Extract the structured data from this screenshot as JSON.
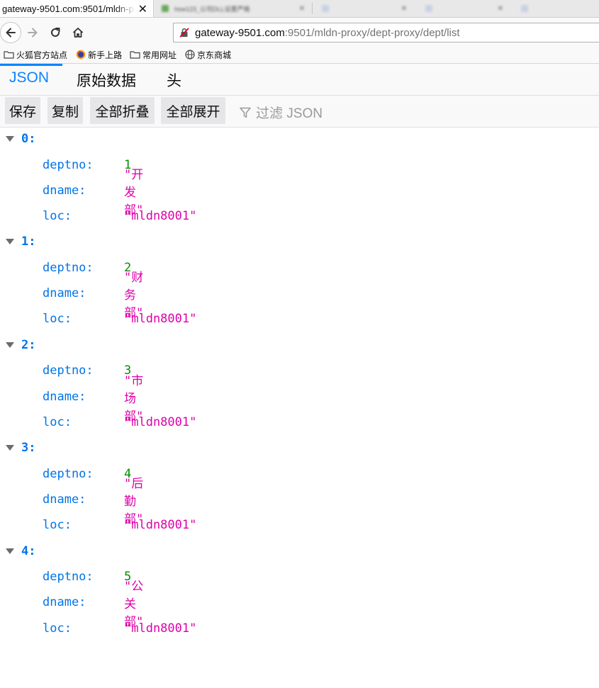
{
  "browser": {
    "active_tab": {
      "title": "gateway-9501.com:9501/mldn-p",
      "close": "✕"
    },
    "blurred_tabs": [
      {
        "title": "hsw123_公司DLL设置严格"
      },
      {
        "title": ""
      },
      {
        "title": ""
      },
      {
        "title": ""
      }
    ],
    "url": {
      "host": "gateway-9501.com",
      "rest": ":9501/mldn-proxy/dept-proxy/dept/list"
    },
    "bookmarks": [
      {
        "label": "火狐官方站点",
        "icon": "folder-icon"
      },
      {
        "label": "新手上路",
        "icon": "firefox-icon"
      },
      {
        "label": "常用网址",
        "icon": "folder-icon"
      },
      {
        "label": "京东商城",
        "icon": "globe-icon"
      }
    ]
  },
  "viewer": {
    "tabs": {
      "json": "JSON",
      "raw": "原始数据",
      "headers": "头"
    },
    "toolbar": {
      "save": "保存",
      "copy": "复制",
      "collapse_all": "全部折叠",
      "expand_all": "全部展开",
      "filter_placeholder": "过滤 JSON"
    }
  },
  "json_rows": [
    {
      "index": "0:",
      "deptno_key": "deptno:",
      "deptno": "1",
      "dname_key": "dname:",
      "dname": "\"开发部\"",
      "loc_key": "loc:",
      "loc": "\"mldn8001\""
    },
    {
      "index": "1:",
      "deptno_key": "deptno:",
      "deptno": "2",
      "dname_key": "dname:",
      "dname": "\"财务部\"",
      "loc_key": "loc:",
      "loc": "\"mldn8001\""
    },
    {
      "index": "2:",
      "deptno_key": "deptno:",
      "deptno": "3",
      "dname_key": "dname:",
      "dname": "\"市场部\"",
      "loc_key": "loc:",
      "loc": "\"mldn8001\""
    },
    {
      "index": "3:",
      "deptno_key": "deptno:",
      "deptno": "4",
      "dname_key": "dname:",
      "dname": "\"后勤部\"",
      "loc_key": "loc:",
      "loc": "\"mldn8001\""
    },
    {
      "index": "4:",
      "deptno_key": "deptno:",
      "deptno": "5",
      "dname_key": "dname:",
      "dname": "\"公关部\"",
      "loc_key": "loc:",
      "loc": "\"mldn8001\""
    }
  ],
  "colors": {
    "key": "#0074e8",
    "number": "#058b00",
    "string": "#dd00a9",
    "accent": "#0a84ff"
  }
}
